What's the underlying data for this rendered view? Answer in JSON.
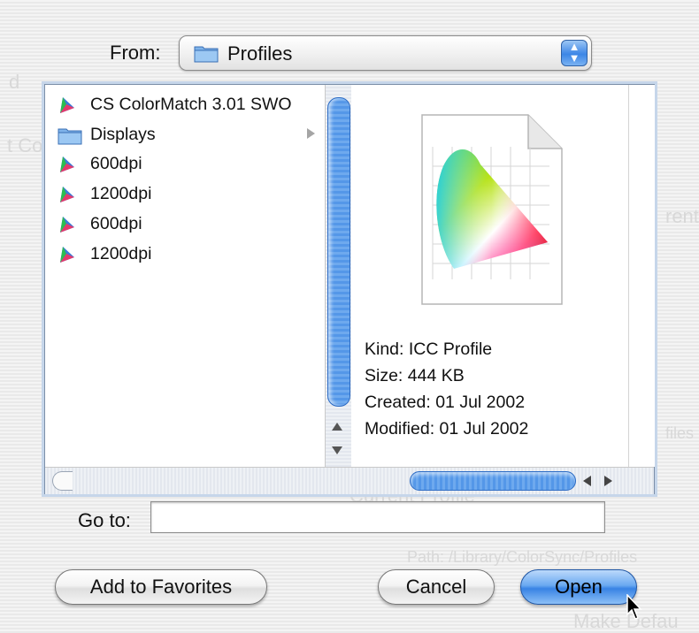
{
  "dialog": {
    "from_label": "From:",
    "from_value": "Profiles",
    "goto_label": "Go to:",
    "goto_value": "",
    "buttons": {
      "add_favorites": "Add to Favorites",
      "cancel": "Cancel",
      "open": "Open"
    }
  },
  "file_list": [
    {
      "name": "CS ColorMatch 3.01 SWO",
      "type": "profile",
      "selected": false
    },
    {
      "name": "Displays",
      "type": "folder",
      "has_children": true
    },
    {
      "name": "600dpi",
      "type": "profile"
    },
    {
      "name": "1200dpi",
      "type": "profile"
    },
    {
      "name": "600dpi",
      "type": "profile"
    },
    {
      "name": "1200dpi",
      "type": "profile"
    }
  ],
  "preview": {
    "icon": "icc-profile-document-icon",
    "kind": "Kind: ICC Profile",
    "size": "Size: 444 KB",
    "created": "Created: 01 Jul 2002",
    "modified": "Modified: 01 Jul 2002"
  },
  "colors": {
    "accent_blue": "#3883e4",
    "scroll_blue": "#5497e8",
    "stripe_light": "#f4f4f4",
    "stripe_dark": "#e9e9e9"
  }
}
